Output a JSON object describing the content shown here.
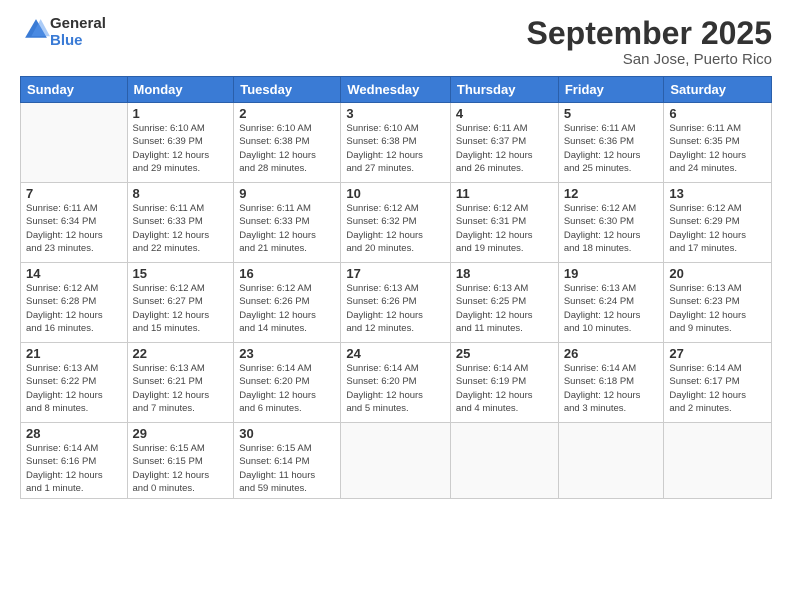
{
  "logo": {
    "general": "General",
    "blue": "Blue"
  },
  "title": "September 2025",
  "subtitle": "San Jose, Puerto Rico",
  "days_header": [
    "Sunday",
    "Monday",
    "Tuesday",
    "Wednesday",
    "Thursday",
    "Friday",
    "Saturday"
  ],
  "weeks": [
    [
      {
        "num": "",
        "info": ""
      },
      {
        "num": "1",
        "info": "Sunrise: 6:10 AM\nSunset: 6:39 PM\nDaylight: 12 hours\nand 29 minutes."
      },
      {
        "num": "2",
        "info": "Sunrise: 6:10 AM\nSunset: 6:38 PM\nDaylight: 12 hours\nand 28 minutes."
      },
      {
        "num": "3",
        "info": "Sunrise: 6:10 AM\nSunset: 6:38 PM\nDaylight: 12 hours\nand 27 minutes."
      },
      {
        "num": "4",
        "info": "Sunrise: 6:11 AM\nSunset: 6:37 PM\nDaylight: 12 hours\nand 26 minutes."
      },
      {
        "num": "5",
        "info": "Sunrise: 6:11 AM\nSunset: 6:36 PM\nDaylight: 12 hours\nand 25 minutes."
      },
      {
        "num": "6",
        "info": "Sunrise: 6:11 AM\nSunset: 6:35 PM\nDaylight: 12 hours\nand 24 minutes."
      }
    ],
    [
      {
        "num": "7",
        "info": "Sunrise: 6:11 AM\nSunset: 6:34 PM\nDaylight: 12 hours\nand 23 minutes."
      },
      {
        "num": "8",
        "info": "Sunrise: 6:11 AM\nSunset: 6:33 PM\nDaylight: 12 hours\nand 22 minutes."
      },
      {
        "num": "9",
        "info": "Sunrise: 6:11 AM\nSunset: 6:33 PM\nDaylight: 12 hours\nand 21 minutes."
      },
      {
        "num": "10",
        "info": "Sunrise: 6:12 AM\nSunset: 6:32 PM\nDaylight: 12 hours\nand 20 minutes."
      },
      {
        "num": "11",
        "info": "Sunrise: 6:12 AM\nSunset: 6:31 PM\nDaylight: 12 hours\nand 19 minutes."
      },
      {
        "num": "12",
        "info": "Sunrise: 6:12 AM\nSunset: 6:30 PM\nDaylight: 12 hours\nand 18 minutes."
      },
      {
        "num": "13",
        "info": "Sunrise: 6:12 AM\nSunset: 6:29 PM\nDaylight: 12 hours\nand 17 minutes."
      }
    ],
    [
      {
        "num": "14",
        "info": "Sunrise: 6:12 AM\nSunset: 6:28 PM\nDaylight: 12 hours\nand 16 minutes."
      },
      {
        "num": "15",
        "info": "Sunrise: 6:12 AM\nSunset: 6:27 PM\nDaylight: 12 hours\nand 15 minutes."
      },
      {
        "num": "16",
        "info": "Sunrise: 6:12 AM\nSunset: 6:26 PM\nDaylight: 12 hours\nand 14 minutes."
      },
      {
        "num": "17",
        "info": "Sunrise: 6:13 AM\nSunset: 6:26 PM\nDaylight: 12 hours\nand 12 minutes."
      },
      {
        "num": "18",
        "info": "Sunrise: 6:13 AM\nSunset: 6:25 PM\nDaylight: 12 hours\nand 11 minutes."
      },
      {
        "num": "19",
        "info": "Sunrise: 6:13 AM\nSunset: 6:24 PM\nDaylight: 12 hours\nand 10 minutes."
      },
      {
        "num": "20",
        "info": "Sunrise: 6:13 AM\nSunset: 6:23 PM\nDaylight: 12 hours\nand 9 minutes."
      }
    ],
    [
      {
        "num": "21",
        "info": "Sunrise: 6:13 AM\nSunset: 6:22 PM\nDaylight: 12 hours\nand 8 minutes."
      },
      {
        "num": "22",
        "info": "Sunrise: 6:13 AM\nSunset: 6:21 PM\nDaylight: 12 hours\nand 7 minutes."
      },
      {
        "num": "23",
        "info": "Sunrise: 6:14 AM\nSunset: 6:20 PM\nDaylight: 12 hours\nand 6 minutes."
      },
      {
        "num": "24",
        "info": "Sunrise: 6:14 AM\nSunset: 6:20 PM\nDaylight: 12 hours\nand 5 minutes."
      },
      {
        "num": "25",
        "info": "Sunrise: 6:14 AM\nSunset: 6:19 PM\nDaylight: 12 hours\nand 4 minutes."
      },
      {
        "num": "26",
        "info": "Sunrise: 6:14 AM\nSunset: 6:18 PM\nDaylight: 12 hours\nand 3 minutes."
      },
      {
        "num": "27",
        "info": "Sunrise: 6:14 AM\nSunset: 6:17 PM\nDaylight: 12 hours\nand 2 minutes."
      }
    ],
    [
      {
        "num": "28",
        "info": "Sunrise: 6:14 AM\nSunset: 6:16 PM\nDaylight: 12 hours\nand 1 minute."
      },
      {
        "num": "29",
        "info": "Sunrise: 6:15 AM\nSunset: 6:15 PM\nDaylight: 12 hours\nand 0 minutes."
      },
      {
        "num": "30",
        "info": "Sunrise: 6:15 AM\nSunset: 6:14 PM\nDaylight: 11 hours\nand 59 minutes."
      },
      {
        "num": "",
        "info": ""
      },
      {
        "num": "",
        "info": ""
      },
      {
        "num": "",
        "info": ""
      },
      {
        "num": "",
        "info": ""
      }
    ]
  ]
}
